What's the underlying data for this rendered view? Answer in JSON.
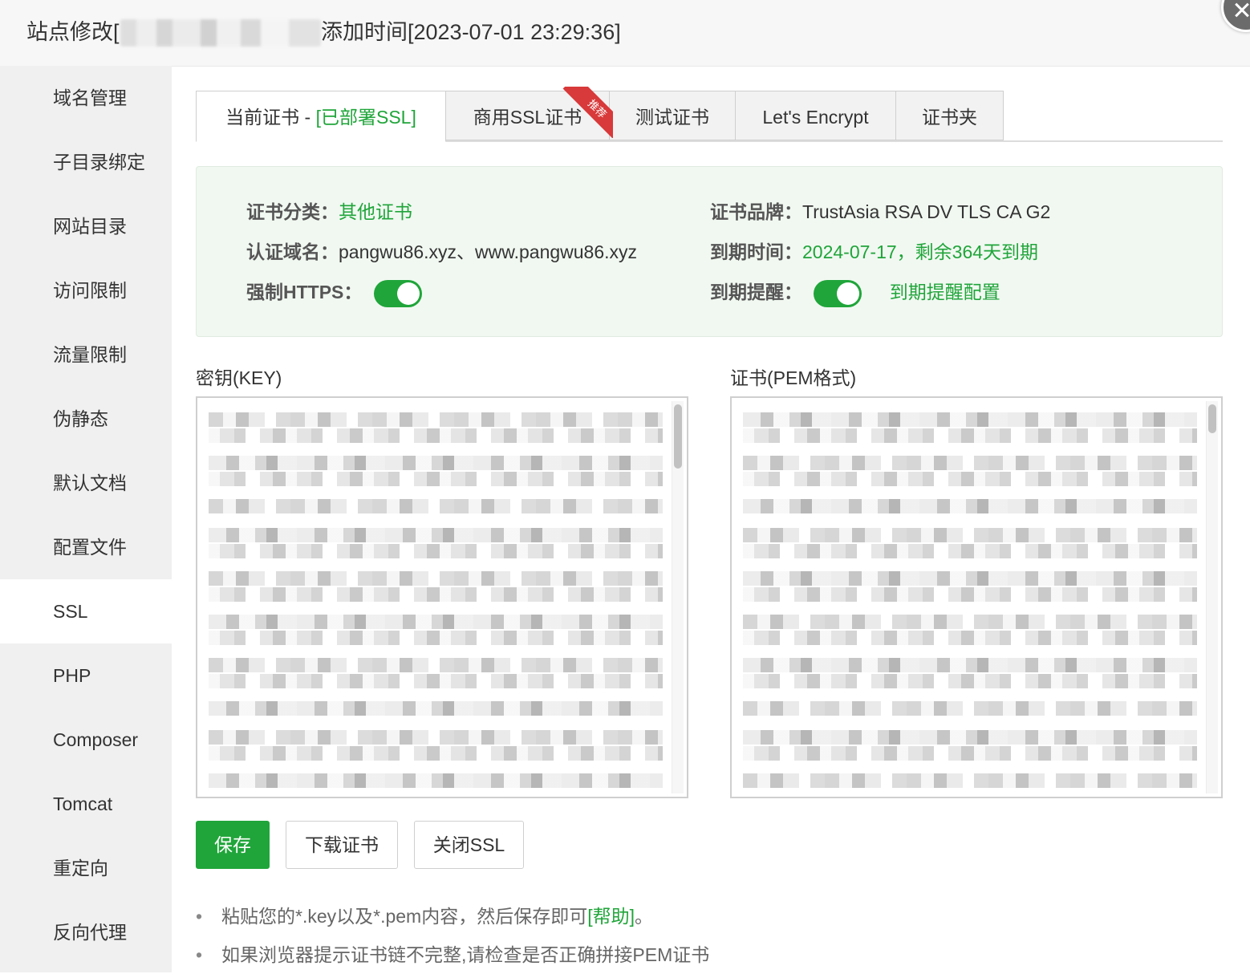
{
  "title": {
    "prefix": "站点修改[",
    "suffix": "添加时间[2023-07-01 23:29:36]"
  },
  "sidebar": {
    "items": [
      {
        "label": "域名管理"
      },
      {
        "label": "子目录绑定"
      },
      {
        "label": "网站目录"
      },
      {
        "label": "访问限制"
      },
      {
        "label": "流量限制"
      },
      {
        "label": "伪静态"
      },
      {
        "label": "默认文档"
      },
      {
        "label": "配置文件"
      },
      {
        "label": "SSL"
      },
      {
        "label": "PHP"
      },
      {
        "label": "Composer"
      },
      {
        "label": "Tomcat"
      },
      {
        "label": "重定向"
      },
      {
        "label": "反向代理"
      }
    ],
    "active": "SSL"
  },
  "tabs": {
    "current_prefix": "当前证书 - ",
    "current_status": "[已部署SSL]",
    "commercial": "商用SSL证书",
    "commercial_ribbon": "推荐",
    "test": "测试证书",
    "letsencrypt": "Let's Encrypt",
    "folder": "证书夹"
  },
  "info": {
    "category_label": "证书分类：",
    "category_value": "其他证书",
    "brand_label": "证书品牌：",
    "brand_value": "TrustAsia RSA DV TLS CA G2",
    "domain_label": "认证域名：",
    "domain_value": "pangwu86.xyz、www.pangwu86.xyz",
    "expire_label": "到期时间：",
    "expire_value": "2024-07-17，剩余364天到期",
    "https_label": "强制HTTPS：",
    "https_on": true,
    "remind_label": "到期提醒：",
    "remind_on": true,
    "remind_config": "到期提醒配置"
  },
  "fields": {
    "key_label": "密钥(KEY)",
    "cert_label": "证书(PEM格式)"
  },
  "buttons": {
    "save": "保存",
    "download": "下载证书",
    "close_ssl": "关闭SSL"
  },
  "tips": {
    "tip1_text": "粘贴您的*.key以及*.pem内容，然后保存即可",
    "tip1_link": "[帮助]",
    "tip1_end": "。",
    "tip2": "如果浏览器提示证书链不完整,请检查是否正确拼接PEM证书"
  },
  "colors": {
    "accent": "#20a53a",
    "ribbon": "#d8393a"
  }
}
